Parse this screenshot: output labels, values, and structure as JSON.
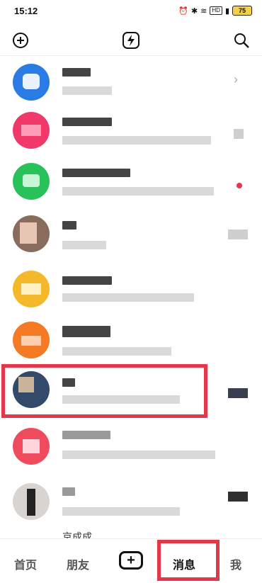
{
  "status": {
    "time": "15:12",
    "hd": "HD",
    "battery": "75"
  },
  "header": {
    "add_icon": "plus-circle-icon",
    "lightning_icon": "lightning-icon",
    "search_icon": "search-icon"
  },
  "list": {
    "peek_name": "京成成"
  },
  "tabs": [
    {
      "label": "首页"
    },
    {
      "label": "朋友"
    },
    {
      "label": "+"
    },
    {
      "label": "消息"
    },
    {
      "label": "我"
    }
  ],
  "colors": {
    "accent_red": "#e4374a",
    "notification_dot": "#e8344e"
  }
}
